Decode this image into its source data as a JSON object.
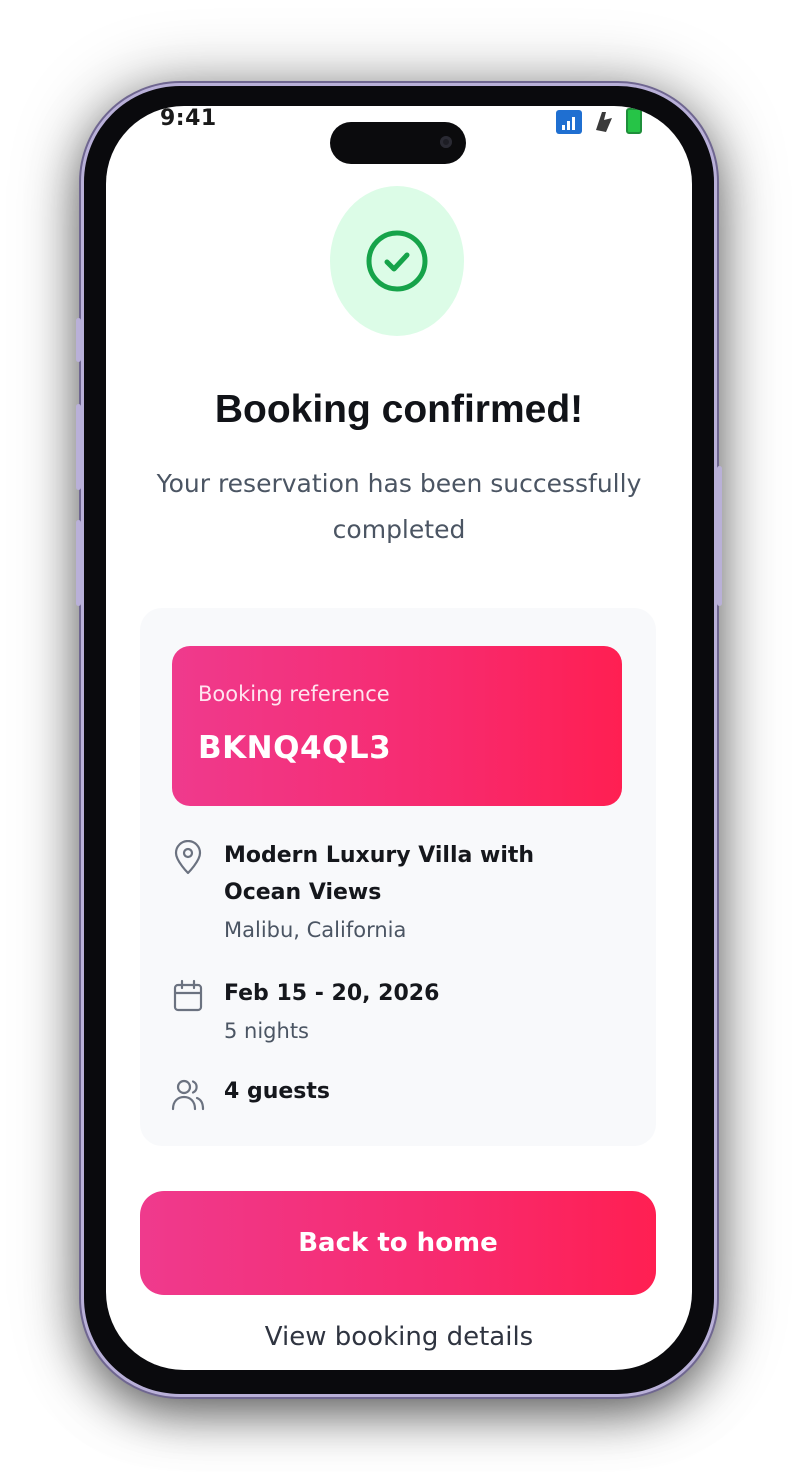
{
  "status_bar": {
    "time": "9:41"
  },
  "confirmation": {
    "icon": "check-circle-icon",
    "title": "Booking confirmed!",
    "subtitle": "Your reservation has been successfully completed"
  },
  "booking": {
    "reference_label": "Booking reference",
    "reference_code": "BKNQ4QL3",
    "property_name": "Modern Luxury Villa with Ocean Views",
    "location": "Malibu, California",
    "dates": "Feb 15 - 20, 2026",
    "nights": "5 nights",
    "guests": "4 guests",
    "icons": {
      "location": "map-pin-icon",
      "dates": "calendar-icon",
      "guests": "users-icon"
    }
  },
  "actions": {
    "primary_label": "Back to home",
    "secondary_label": "View booking details"
  },
  "colors": {
    "accent_start": "#ef3a8d",
    "accent_end": "#ff1f52",
    "success": "#16a34a",
    "success_bg": "#dcfce7"
  }
}
